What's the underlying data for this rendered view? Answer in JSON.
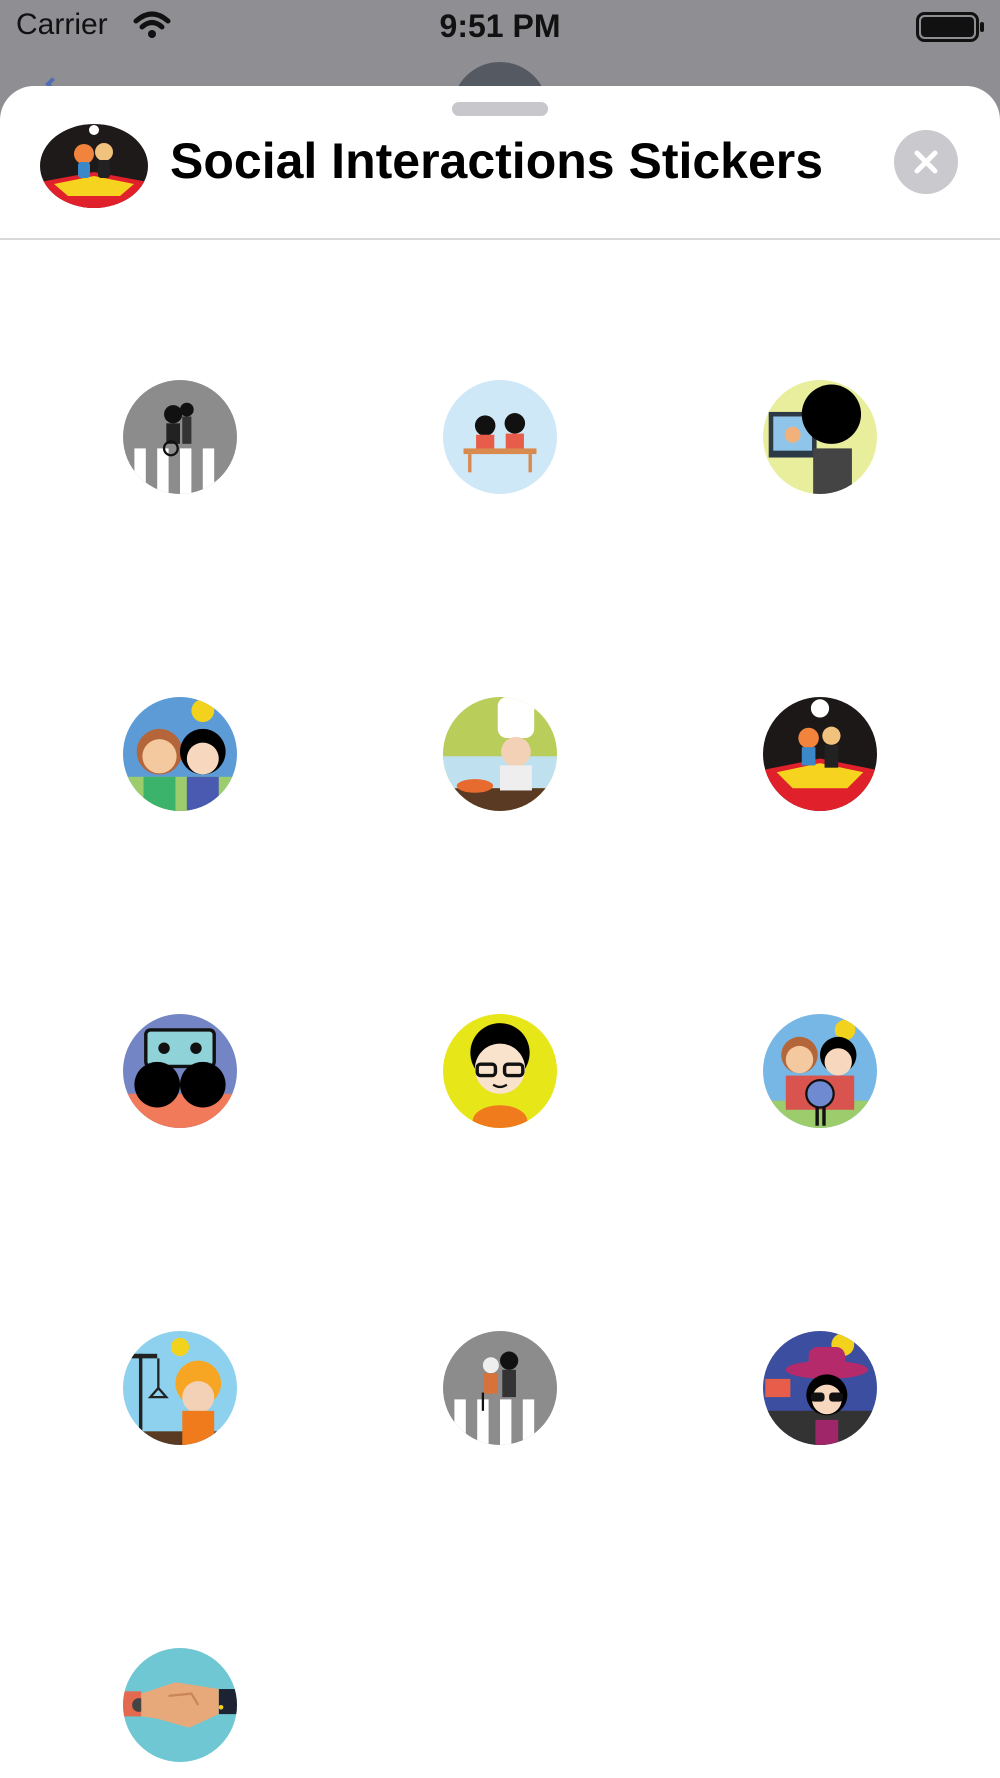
{
  "status_bar": {
    "carrier": "Carrier",
    "time": "9:51 PM",
    "icons": [
      "wifi-icon",
      "battery-icon"
    ]
  },
  "sheet": {
    "title": "Social Interactions Stickers",
    "app_icon": "sticker-pack-icon",
    "close_icon": "close-icon"
  },
  "stickers": [
    {
      "name": "crosswalk-wheelchair-sticker"
    },
    {
      "name": "classroom-students-sticker"
    },
    {
      "name": "video-call-sticker"
    },
    {
      "name": "friends-outdoors-sticker"
    },
    {
      "name": "chef-sticker"
    },
    {
      "name": "dancing-couple-sticker"
    },
    {
      "name": "retro-music-sticker"
    },
    {
      "name": "driver-sticker"
    },
    {
      "name": "family-photo-sticker"
    },
    {
      "name": "construction-worker-sticker"
    },
    {
      "name": "crosswalk-elderly-sticker"
    },
    {
      "name": "sunglasses-hat-sticker"
    },
    {
      "name": "handshake-sticker"
    }
  ],
  "colors": {
    "status_bar_bg": "#8e8e93",
    "sheet_bg": "#ffffff",
    "close_button_bg": "#c9c9ce",
    "divider": "#d9d9dc"
  }
}
